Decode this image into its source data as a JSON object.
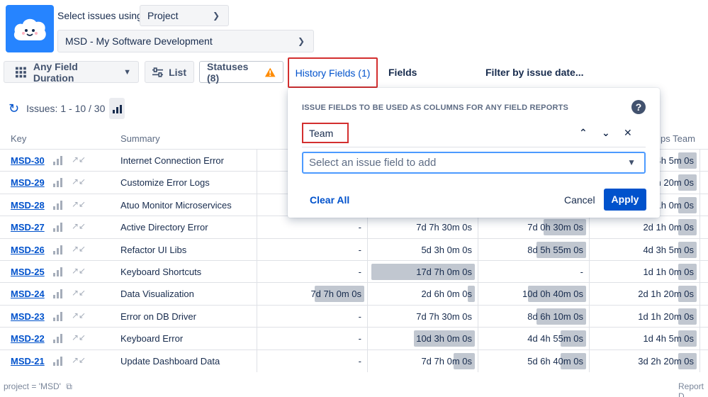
{
  "header": {
    "select_label": "Select issues using",
    "select_mode": "Project",
    "project": "MSD - My Software Development"
  },
  "toolbar": {
    "any_field_duration": "Any Field Duration",
    "list": "List",
    "statuses": "Statuses (8)",
    "history_fields": "History Fields (1)",
    "fields": "Fields",
    "filter_by_date": "Filter by issue date..."
  },
  "issues": {
    "count": "Issues: 1 - 10 / 30"
  },
  "table": {
    "headers": {
      "key": "Key",
      "summary": "Summary",
      "partial": "ps Team"
    },
    "rows": [
      {
        "key": "MSD-30",
        "summary": "Internet Connection Error",
        "c1": "",
        "c2": "",
        "c3": "",
        "c4": "4h 5m 0s"
      },
      {
        "key": "MSD-29",
        "summary": "Customize Error Logs",
        "c1": "",
        "c2": "",
        "c3": "",
        "c4": "h 20m 0s"
      },
      {
        "key": "MSD-28",
        "summary": "Atuo Monitor Microservices",
        "c1": "",
        "c2": "",
        "c3": "",
        "c4": "1h 0m 0s"
      },
      {
        "key": "MSD-27",
        "summary": "Active Directory Error",
        "c1": "-",
        "c2": "7d 7h 30m 0s",
        "c3": "7d 0h 30m 0s",
        "c4": "2d 1h 0m 0s"
      },
      {
        "key": "MSD-26",
        "summary": "Refactor UI Libs",
        "c1": "-",
        "c2": "5d 3h 0m 0s",
        "c3": "8d 5h 55m 0s",
        "c4": "4d 3h 5m 0s"
      },
      {
        "key": "MSD-25",
        "summary": "Keyboard Shortcuts",
        "c1": "-",
        "c2": "17d 7h 0m 0s",
        "c3": "-",
        "c4": "1d 1h 0m 0s"
      },
      {
        "key": "MSD-24",
        "summary": "Data Visualization",
        "c1": "7d 7h 0m 0s",
        "c2": "2d 6h 0m 0s",
        "c3": "10d 0h 40m 0s",
        "c4": "2d 1h 20m 0s"
      },
      {
        "key": "MSD-23",
        "summary": "Error on DB Driver",
        "c1": "-",
        "c2": "7d 7h 30m 0s",
        "c3": "8d 6h 10m 0s",
        "c4": "1d 1h 20m 0s"
      },
      {
        "key": "MSD-22",
        "summary": "Keyboard Error",
        "c1": "-",
        "c2": "10d 3h 0m 0s",
        "c3": "4d 4h 55m 0s",
        "c4": "1d 4h 5m 0s"
      },
      {
        "key": "MSD-21",
        "summary": "Update Dashboard Data",
        "c1": "-",
        "c2": "7d 7h 0m 0s",
        "c3": "5d 6h 40m 0s",
        "c4": "3d 2h 20m 0s"
      }
    ]
  },
  "footer": {
    "jql": "project = 'MSD'",
    "right": "Report D"
  },
  "popover": {
    "title": "ISSUE FIELDS TO BE USED AS COLUMNS FOR ANY FIELD REPORTS",
    "selected_field": "Team",
    "select_placeholder": "Select an issue field to add",
    "clear_all": "Clear All",
    "cancel": "Cancel",
    "apply": "Apply"
  },
  "colors": {
    "accent": "#0052cc",
    "highlight": "#d32f2f",
    "logo_bg": "#2684ff"
  }
}
